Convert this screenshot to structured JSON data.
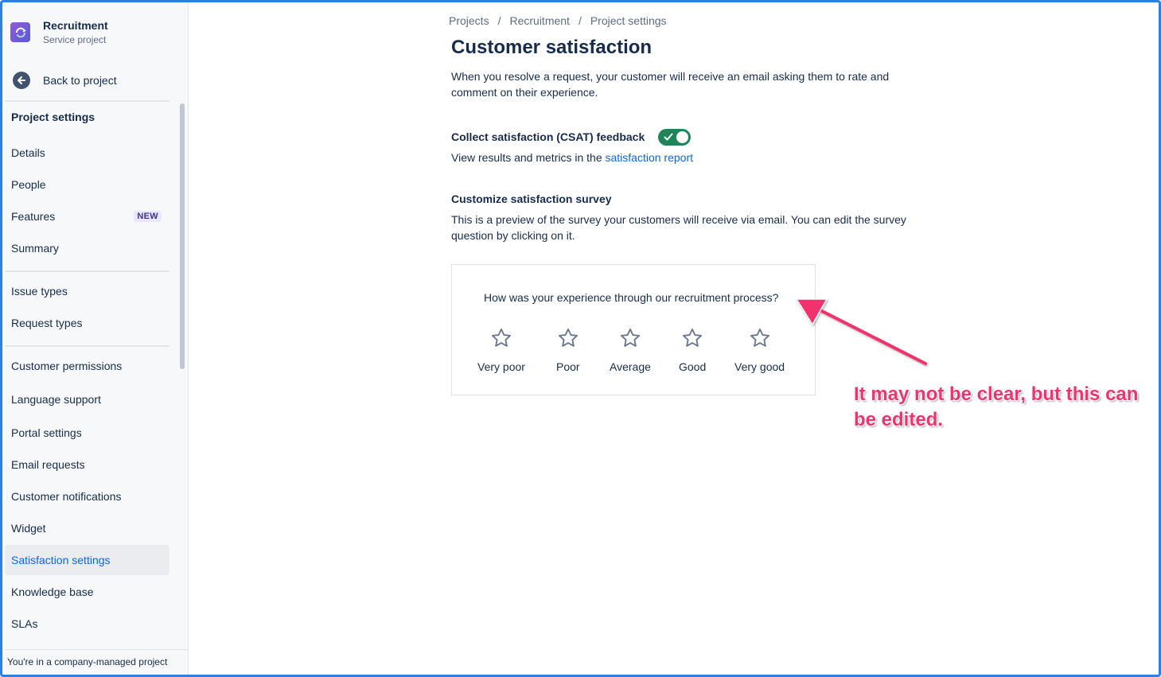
{
  "project": {
    "name": "Recruitment",
    "type": "Service project"
  },
  "back_link": "Back to project",
  "nav": {
    "title": "Project settings",
    "group1": [
      {
        "label": "Details"
      },
      {
        "label": "People"
      },
      {
        "label": "Features",
        "badge": "NEW"
      },
      {
        "label": "Summary"
      }
    ],
    "group2": [
      {
        "label": "Issue types"
      },
      {
        "label": "Request types"
      }
    ],
    "group3": [
      {
        "label": "Customer permissions"
      },
      {
        "label": "Language support"
      },
      {
        "label": "Portal settings"
      },
      {
        "label": "Email requests"
      },
      {
        "label": "Customer notifications"
      },
      {
        "label": "Widget"
      },
      {
        "label": "Satisfaction settings",
        "active": true
      },
      {
        "label": "Knowledge base"
      },
      {
        "label": "SLAs"
      }
    ],
    "footer": "You're in a company-managed project"
  },
  "breadcrumb": [
    "Projects",
    "Recruitment",
    "Project settings"
  ],
  "breadcrumb_separator": "/",
  "page": {
    "title": "Customer satisfaction",
    "intro": "When you resolve a request, your customer will receive an email asking them to rate and comment on their experience."
  },
  "csat": {
    "label": "Collect satisfaction (CSAT) feedback",
    "enabled": true,
    "sub_prefix": "View results and metrics in the ",
    "sub_link": "satisfaction report"
  },
  "survey": {
    "title": "Customize satisfaction survey",
    "description": "This is a preview of the survey your customers will receive via email. You can edit the survey question by clicking on it.",
    "question": "How was your experience through our recruitment process?",
    "ratings": [
      "Very poor",
      "Poor",
      "Average",
      "Good",
      "Very good"
    ]
  },
  "annotation": {
    "text": "It may not be clear, but this can be edited.",
    "color": "#f0326e"
  },
  "colors": {
    "accent": "#0c66e4",
    "toggle_on": "#1f845a",
    "frame": "#2f7fe3"
  }
}
